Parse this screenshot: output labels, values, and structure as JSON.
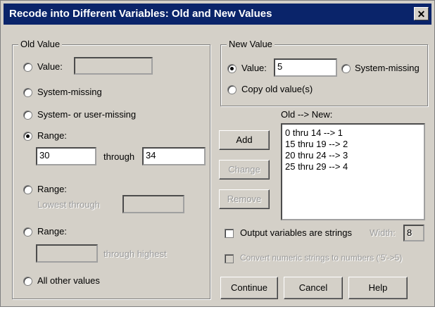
{
  "window": {
    "title": "Recode into Different Variables: Old and New Values",
    "close_glyph": "✕"
  },
  "old_value": {
    "legend": "Old Value",
    "value_label": "Value:",
    "value_input": "",
    "system_missing": "System-missing",
    "system_or_user_missing": "System- or user-missing",
    "range_label": "Range:",
    "range_from": "30",
    "through": "through",
    "range_to": "34",
    "range_lowest_label": "Range:",
    "lowest_through": "Lowest through",
    "lowest_input": "",
    "range_highest_label": "Range:",
    "highest_input": "",
    "through_highest": "through highest",
    "all_other_values": "All other values",
    "selected": "range"
  },
  "new_value": {
    "legend": "New Value",
    "value_label": "Value:",
    "value_input": "5",
    "system_missing": "System-missing",
    "copy_old": "Copy old value(s)",
    "selected": "value"
  },
  "mapping": {
    "label": "Old --> New:",
    "items": [
      "0 thru 14 --> 1",
      "15 thru 19 --> 2",
      "20 thru 24 --> 3",
      "25 thru 29 --> 4"
    ]
  },
  "buttons": {
    "add": "Add",
    "change": "Change",
    "remove": "Remove",
    "continue": "Continue",
    "cancel": "Cancel",
    "help": "Help"
  },
  "options": {
    "output_strings": "Output variables are strings",
    "width_label": "Width:",
    "width_value": "8",
    "convert_numeric": "Convert numeric strings to numbers ('5'->5)"
  }
}
